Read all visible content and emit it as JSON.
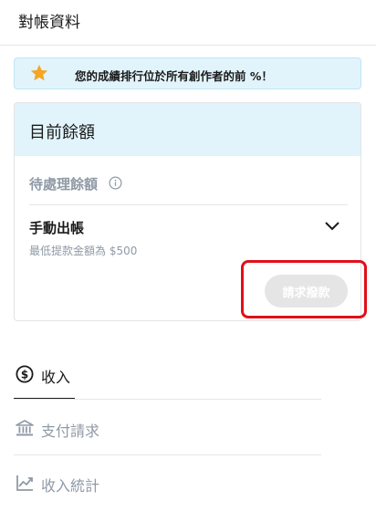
{
  "header": {
    "title": "對帳資料"
  },
  "banner": {
    "text": "您的成績排行位於所有創作者的前  %！",
    "icon": "star-icon"
  },
  "balance_card": {
    "title": "目前餘額",
    "pending_label": "待處理餘額",
    "info_icon": "info-icon",
    "manual_payout_label": "手動出帳",
    "min_amount_text": "最低提款金額為 $500",
    "request_button_label": "請求撥款",
    "expand_icon": "chevron-down-icon"
  },
  "nav": {
    "items": [
      {
        "label": "收入",
        "icon": "dollar-circle-icon",
        "active": true
      },
      {
        "label": "支付請求",
        "icon": "bank-icon",
        "active": false
      },
      {
        "label": "收入統計",
        "icon": "trend-chart-icon",
        "active": false
      }
    ]
  },
  "colors": {
    "accent_bg": "#e2f4fb",
    "star": "#f5a623",
    "highlight": "#e0101a",
    "muted_text": "#8f9aa6",
    "disabled_button": "#e5e5e5"
  }
}
